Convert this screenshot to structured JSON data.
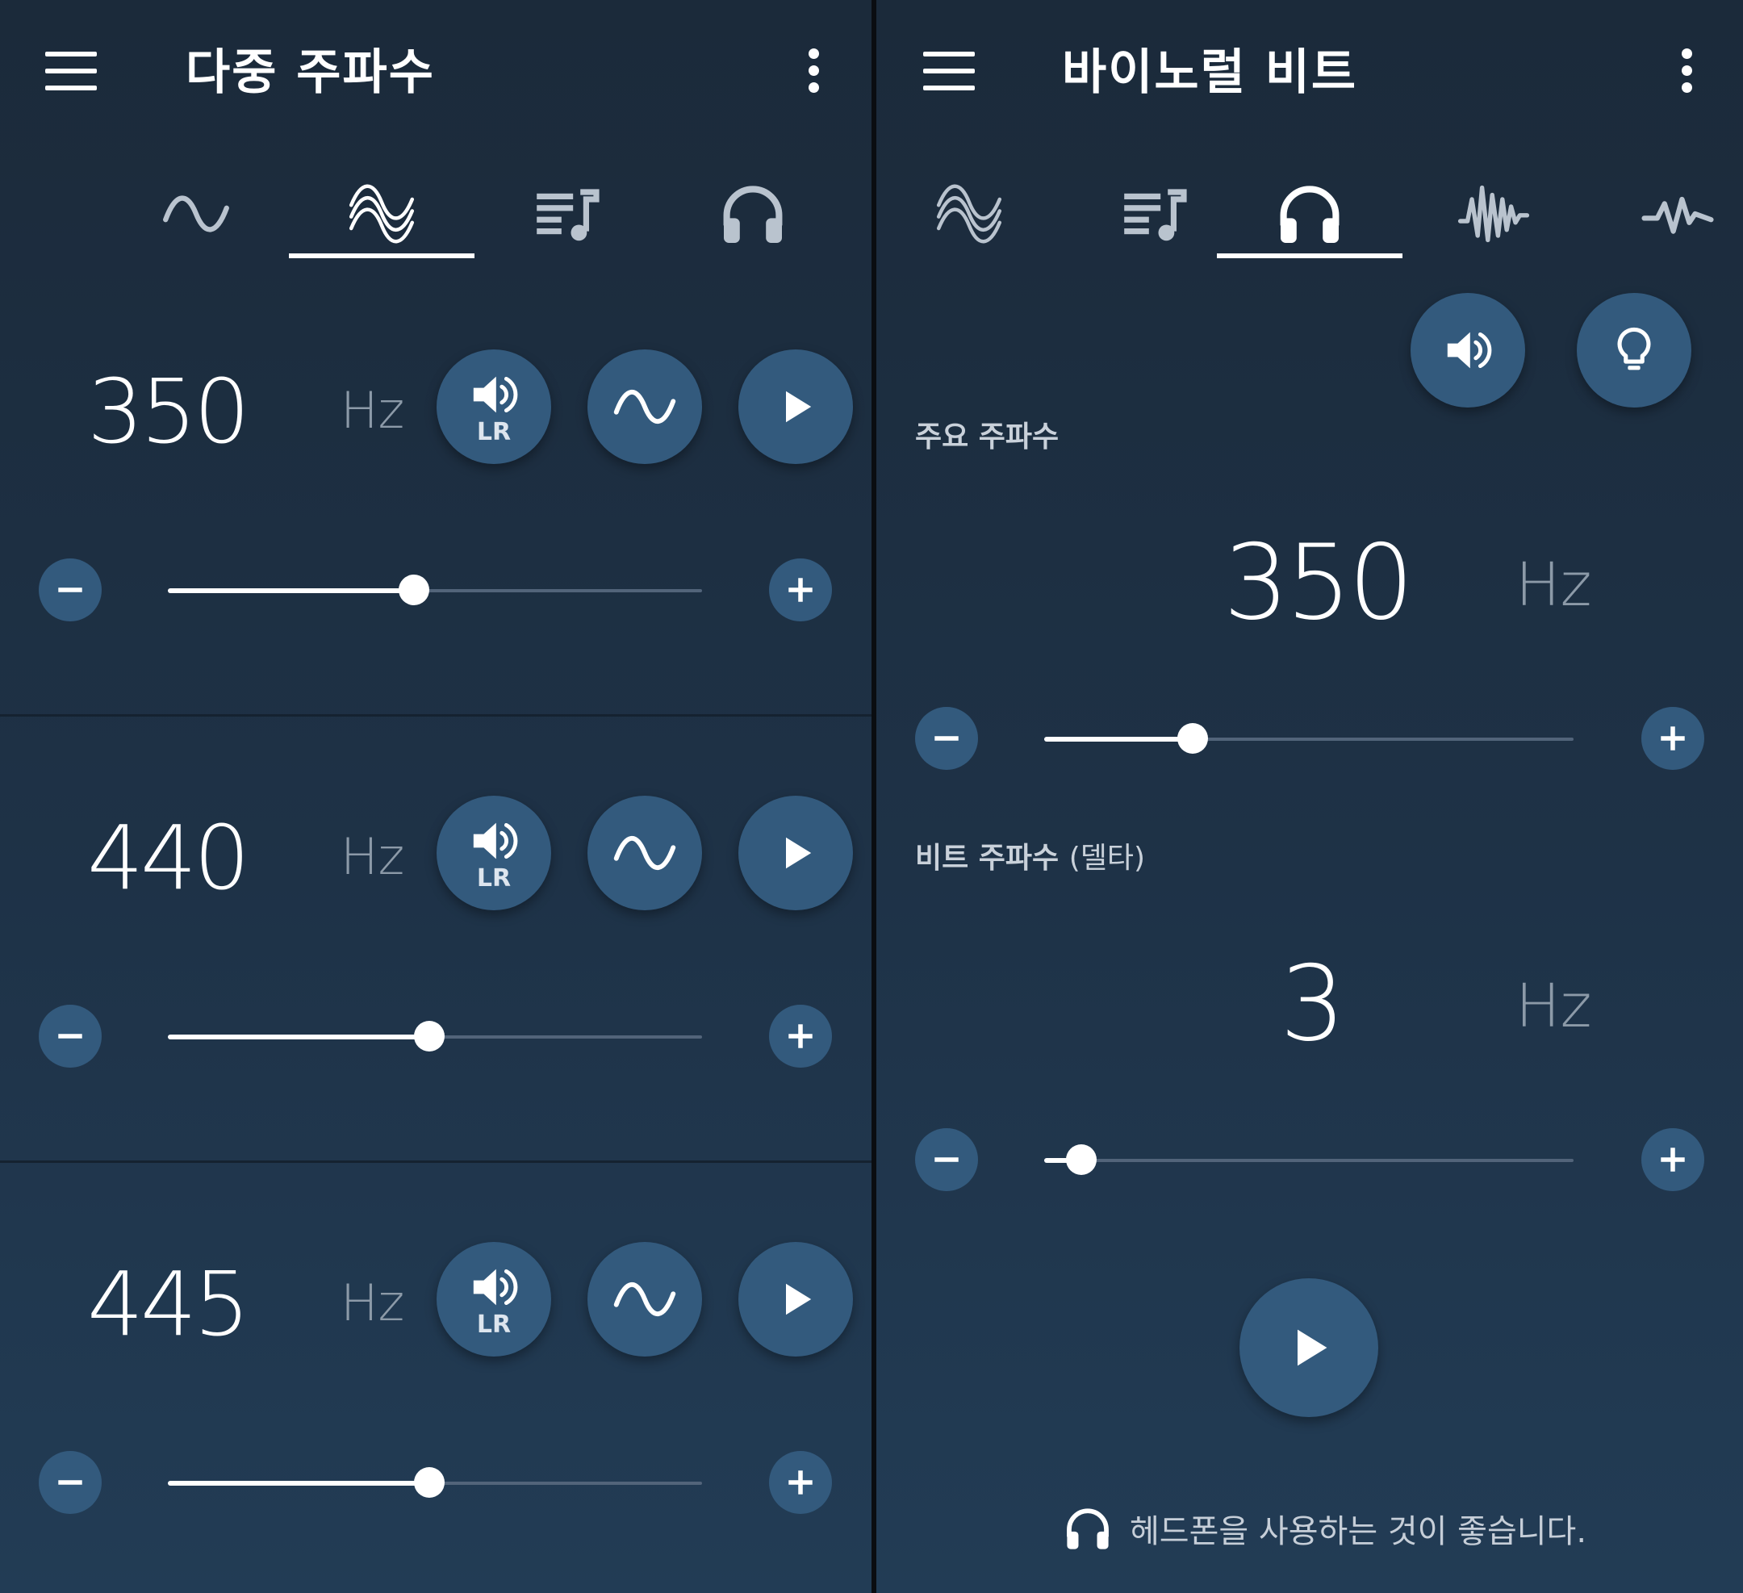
{
  "left": {
    "title": "다중 주파수",
    "tabs": [
      {
        "icon": "sine-wave-icon",
        "selected": false
      },
      {
        "icon": "multi-wave-icon",
        "selected": true
      },
      {
        "icon": "playlist-icon",
        "selected": false
      },
      {
        "icon": "headphones-icon",
        "selected": false
      }
    ],
    "rows": [
      {
        "frequency": "350",
        "unit": "Hz",
        "lr_label": "LR",
        "slider_value": 0.46
      },
      {
        "frequency": "440",
        "unit": "Hz",
        "lr_label": "LR",
        "slider_value": 0.49
      },
      {
        "frequency": "445",
        "unit": "Hz",
        "lr_label": "LR",
        "slider_value": 0.49
      }
    ]
  },
  "right": {
    "title": "바이노럴 비트",
    "tabs": [
      {
        "icon": "multi-wave-icon",
        "selected": false
      },
      {
        "icon": "playlist-icon",
        "selected": false
      },
      {
        "icon": "headphones-icon",
        "selected": true
      },
      {
        "icon": "noise-wave-icon",
        "selected": false
      },
      {
        "icon": "pulse-icon",
        "selected": false
      }
    ],
    "main": {
      "label": "주요 주파수",
      "frequency": "350",
      "unit": "Hz",
      "slider_value": 0.28
    },
    "beat": {
      "label": "비트 주파수",
      "label_suffix": "(델타)",
      "frequency": "3",
      "unit": "Hz",
      "slider_value": 0.07
    },
    "note": "헤드폰을 사용하는 것이 좋습니다."
  },
  "colors": {
    "accent": "#335a7d",
    "background_top": "#1b2a3a",
    "background_bottom": "#223c55"
  }
}
